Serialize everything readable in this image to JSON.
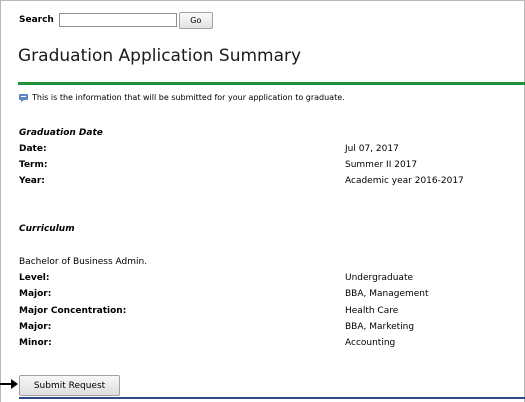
{
  "search": {
    "label": "Search",
    "value": "",
    "go_label": "Go"
  },
  "page_title": "Graduation Application Summary",
  "info_text": "This is the information that will be submitted for your application to graduate.",
  "graduation": {
    "heading": "Graduation Date",
    "rows": [
      {
        "label": "Date:",
        "value": "Jul 07, 2017"
      },
      {
        "label": "Term:",
        "value": "Summer II 2017"
      },
      {
        "label": "Year:",
        "value": "Academic year 2016-2017"
      }
    ]
  },
  "curriculum": {
    "heading": "Curriculum",
    "program": "Bachelor of Business Admin.",
    "rows": [
      {
        "label": "Level:",
        "value": "Undergraduate"
      },
      {
        "label": "Major:",
        "value": "BBA, Management"
      },
      {
        "label": "Major Concentration:",
        "value": "Health Care"
      },
      {
        "label": "Major:",
        "value": "BBA, Marketing"
      },
      {
        "label": "Minor:",
        "value": "Accounting"
      }
    ]
  },
  "submit_label": "Submit Request",
  "colors": {
    "title_rule": "#22913c",
    "bottom_rule": "#2b4a8c",
    "info_icon": "#5b86c4"
  },
  "icons": {
    "info": "info-icon",
    "pointer": "arrow-pointer-icon"
  }
}
